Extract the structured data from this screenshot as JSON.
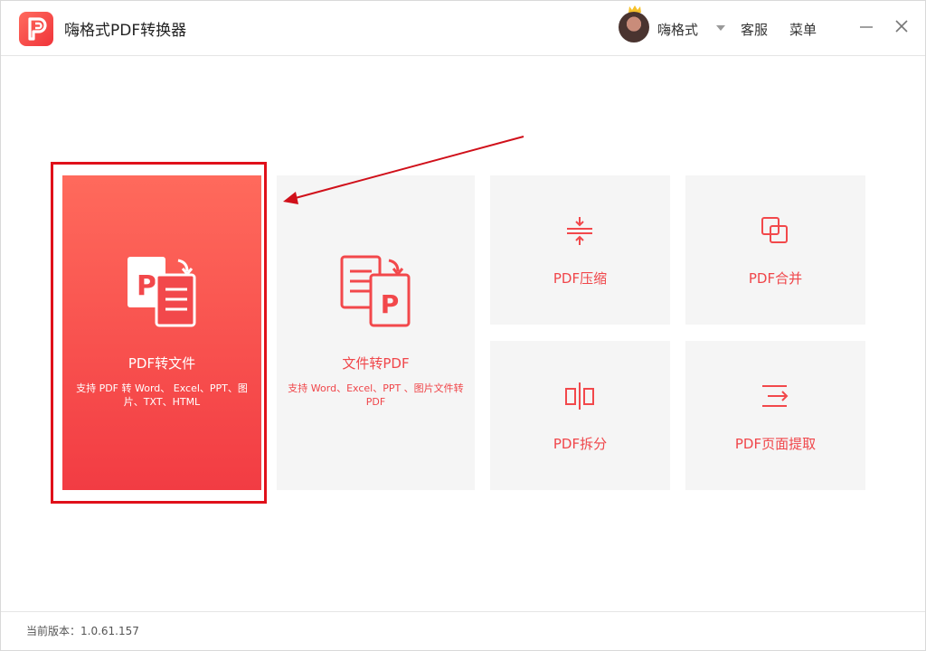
{
  "app": {
    "title": "嗨格式PDF转换器",
    "logo_icon": "pdf-logo-icon"
  },
  "header": {
    "user_name": "嗨格式",
    "service_label": "客服",
    "menu_label": "菜单"
  },
  "cards": {
    "pdf_to_file": {
      "label": "PDF转文件",
      "desc": "支持 PDF 转 Word、 Excel、PPT、图片、TXT、HTML"
    },
    "file_to_pdf": {
      "label": "文件转PDF",
      "desc": "支持 Word、Excel、PPT 、图片文件转 PDF"
    },
    "compress": {
      "label": "PDF压缩"
    },
    "merge": {
      "label": "PDF合并"
    },
    "split": {
      "label": "PDF拆分"
    },
    "extract": {
      "label": "PDF页面提取"
    }
  },
  "footer": {
    "version": "当前版本：1.0.61.157"
  },
  "colors": {
    "accent": "#f0464a",
    "highlight": "#e0101a",
    "card_bg": "#f5f5f5"
  }
}
